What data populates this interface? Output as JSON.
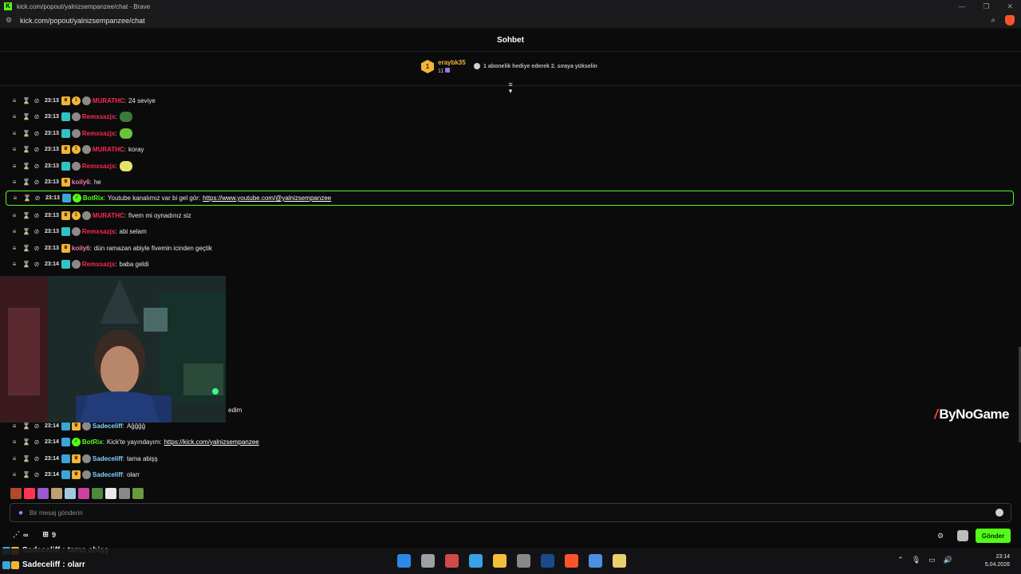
{
  "browser": {
    "title": "kick.com/popout/yalnizsempanzee/chat - Brave",
    "url": "kick.com/popout/yalnizsempanzee/chat",
    "controls": [
      "—",
      "❐",
      "✕"
    ]
  },
  "chat": {
    "header": "Sohbet",
    "leader": {
      "rank": "1",
      "name": "eraybk35",
      "count": "11"
    },
    "promo": "1 abonelik hediye ederek 2. sıraya yükselin"
  },
  "messages": [
    {
      "time": "23:13",
      "name": "MURATHC",
      "name_color": "#ff2a4a",
      "text": "24 seviye",
      "badges": [
        "crown",
        "one",
        "grey"
      ]
    },
    {
      "time": "23:13",
      "name": "Remxsazjs",
      "name_color": "#ff2a4a",
      "text": "",
      "badges": [
        "teal",
        "grey"
      ],
      "emote": "#3b7a3b"
    },
    {
      "time": "23:13",
      "name": "Remxsazjs",
      "name_color": "#ff2a4a",
      "text": "",
      "badges": [
        "teal",
        "grey"
      ],
      "emote": "#69c23a"
    },
    {
      "time": "23:13",
      "name": "MURATHC",
      "name_color": "#ff2a4a",
      "text": "koray",
      "badges": [
        "crown",
        "one",
        "grey"
      ]
    },
    {
      "time": "23:13",
      "name": "Remxsazjs",
      "name_color": "#ff2a4a",
      "text": "",
      "badges": [
        "teal",
        "grey"
      ],
      "emote": "#e6e36a"
    },
    {
      "time": "23:13",
      "name": "koily6",
      "name_color": "#f07ab0",
      "text": "he",
      "badges": [
        "crown"
      ]
    },
    {
      "time": "23:13",
      "name": "BotRix",
      "name_color": "#53fc18",
      "text": "Youtube kanalımız var bi gel gör:",
      "link": "https://www.youtube.com/@yalnizsempanzee",
      "badges": [
        "blue",
        "green"
      ],
      "highlight": true
    },
    {
      "time": "23:13",
      "name": "MURATHC",
      "name_color": "#ff2a4a",
      "text": "fivem mi oynadınız siz",
      "badges": [
        "crown",
        "one",
        "grey"
      ]
    },
    {
      "time": "23:13",
      "name": "Remxsazjs",
      "name_color": "#ff2a4a",
      "text": "abi selam",
      "badges": [
        "teal",
        "grey"
      ]
    },
    {
      "time": "23:13",
      "name": "koily6",
      "name_color": "#f07ab0",
      "text": "dün ramazan abiyle fivemin icinden geçtik",
      "badges": [
        "crown"
      ]
    },
    {
      "time": "23:14",
      "name": "Remxsazjs",
      "name_color": "#ff2a4a",
      "text": "baba geldi",
      "badges": [
        "teal",
        "grey"
      ]
    }
  ],
  "partial_text": "edim",
  "messages_bottom": [
    {
      "time": "23:14",
      "name": "Sadeceliff",
      "name_color": "#7fd8ff",
      "text": "Ağğğğ",
      "badges": [
        "blue",
        "crown",
        "grey"
      ]
    },
    {
      "time": "23:14",
      "name": "BotRix",
      "name_color": "#53fc18",
      "text": "Kick'te yayındayım:",
      "link": "https://kick.com/yalnizsempanzee",
      "badges": [
        "blue",
        "green"
      ]
    },
    {
      "time": "23:14",
      "name": "Sadeceliff",
      "name_color": "#7fd8ff",
      "text": "tama abişş",
      "badges": [
        "blue",
        "crown",
        "grey"
      ]
    },
    {
      "time": "23:14",
      "name": "Sadeceliff",
      "name_color": "#7fd8ff",
      "text": "olarr",
      "badges": [
        "blue",
        "crown",
        "grey"
      ]
    }
  ],
  "emote_bar": [
    "#b34a2a",
    "#ff3355",
    "#9a5ad0",
    "#c0a070",
    "#a0c8e0",
    "#d040a0",
    "#4a8a3a",
    "#e8e8e8",
    "#888888",
    "#6a9a3a"
  ],
  "input": {
    "placeholder": "Bir mesaj gönderin"
  },
  "footer": {
    "infinity": "∞",
    "gift_count": "9",
    "send": "Gönder"
  },
  "overlay": [
    {
      "name": "Sadeceliff",
      "text": "tama abişş"
    },
    {
      "name": "Sadeceliff",
      "text": "olarr"
    }
  ],
  "watermark": "ByNoGame",
  "clock": {
    "time": "23:14",
    "date": "5.04.2026"
  },
  "taskbar_icons": [
    "#2a8ae6",
    "#9aa0a6",
    "#d04a4a",
    "#3aa0e8",
    "#f2c038",
    "#888888",
    "#1a4a8a",
    "#fb542b",
    "#4a90e2",
    "#e8d070"
  ]
}
